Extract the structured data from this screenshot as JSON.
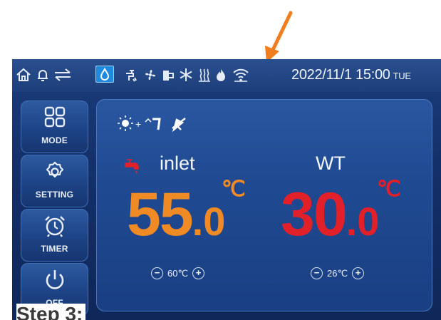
{
  "status_bar": {
    "datetime": "2022/11/1 15:00",
    "day_of_week": "TUE",
    "icons": [
      "home-icon",
      "bell-icon",
      "transfer-icon",
      "water-drop-icon",
      "tap-icon",
      "fan-icon",
      "pump-icon",
      "defrost-icon",
      "heater-icon",
      "flame-icon",
      "wifi-icon"
    ]
  },
  "sidebar": {
    "mode_label": "MODE",
    "setting_label": "SETTING",
    "timer_label": "TIMER",
    "off_label": "OFF"
  },
  "panel": {
    "inlet": {
      "label": "inlet",
      "value_int": "55",
      "value_dec": ".0",
      "unit": "℃",
      "setpoint": "60℃",
      "color": "#f08a24"
    },
    "wt": {
      "label": "WT",
      "value_int": "30",
      "value_dec": ".0",
      "unit": "℃",
      "setpoint": "26℃",
      "color": "#e2202a"
    }
  },
  "caption": "Step 3:",
  "colors": {
    "arrow": "#f07d1e",
    "screen_bg": "#14306a",
    "panel_bg": "#1f4a92"
  }
}
